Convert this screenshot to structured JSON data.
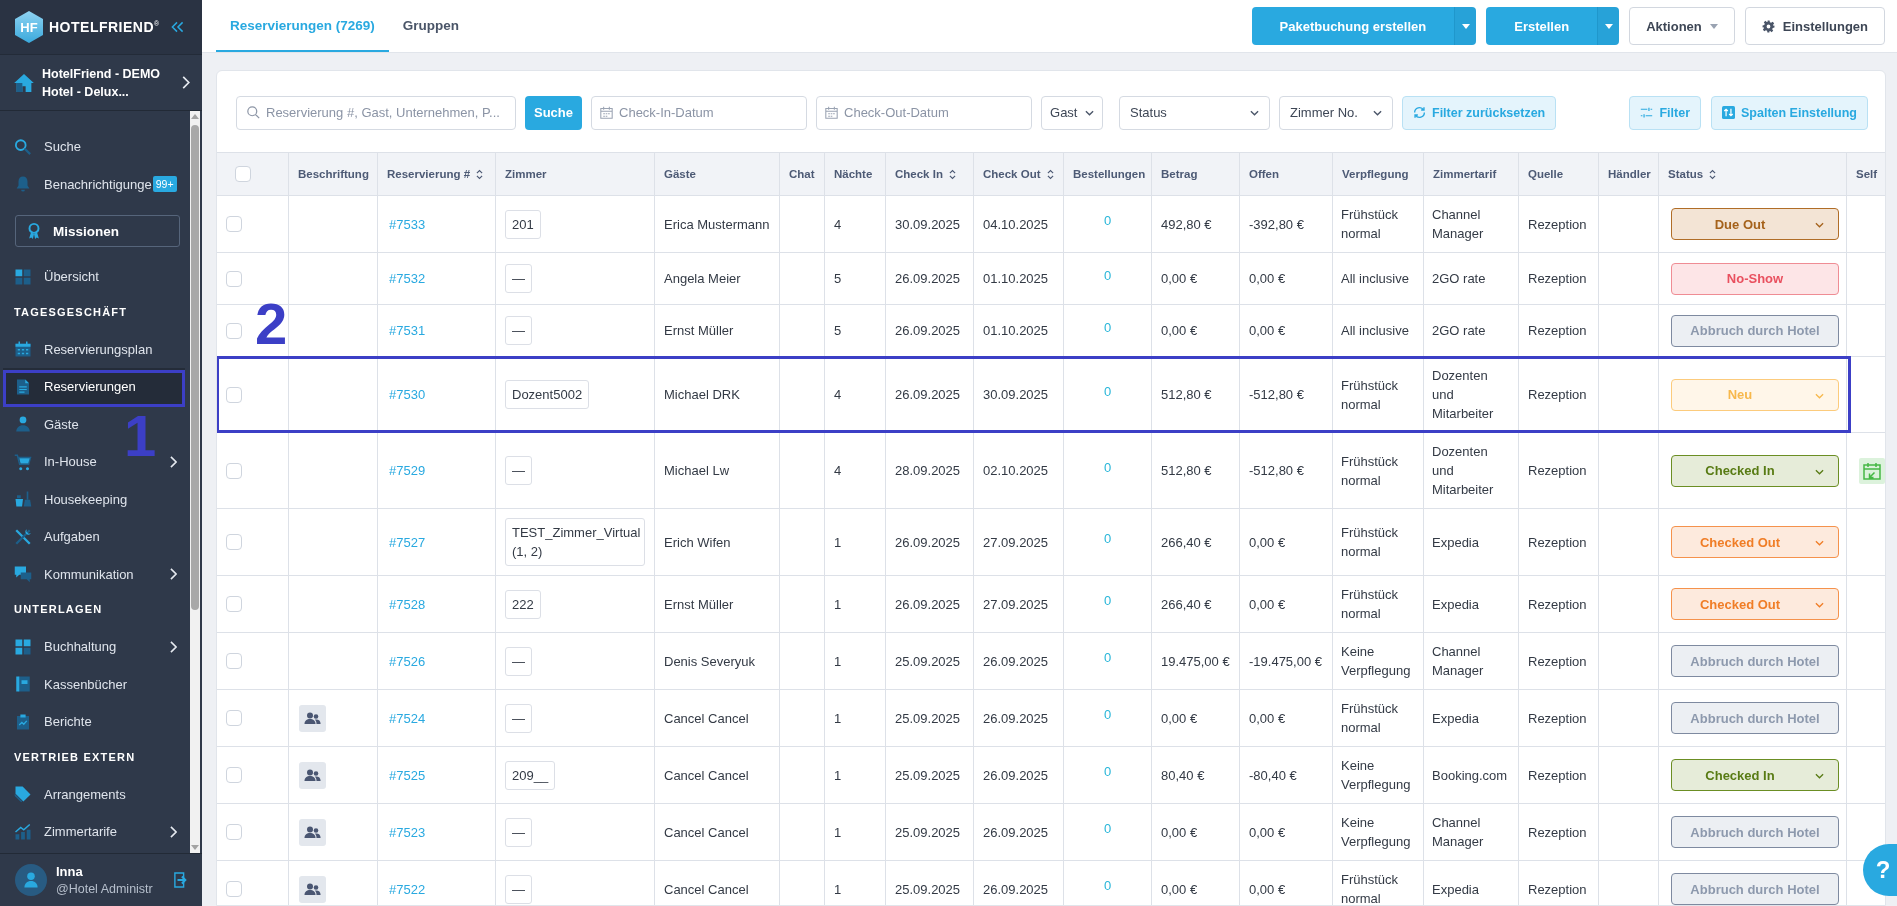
{
  "sidebar": {
    "logo": {
      "mark": "HF",
      "text": "HOTELFRIEND$^{®}$"
    },
    "hotel": "HotelFriend - DEMO Hotel - Delux...",
    "nav": [
      {
        "kind": "item",
        "label": "Suche",
        "selected": false,
        "submenu": false
      },
      {
        "kind": "item",
        "label": "Benachrichtigunge",
        "selected": false,
        "submenu": false,
        "badge": "99+"
      },
      {
        "kind": "button",
        "label": "Missionen"
      },
      {
        "kind": "item",
        "label": "Übersicht",
        "selected": false,
        "submenu": false
      },
      {
        "kind": "section",
        "label": "TAGESGESCHÄFT"
      },
      {
        "kind": "item",
        "label": "Reservierungsplan",
        "selected": false,
        "submenu": false
      },
      {
        "kind": "item",
        "label": "Reservierungen",
        "selected": true,
        "submenu": false,
        "callout": "1"
      },
      {
        "kind": "item",
        "label": "Gäste",
        "selected": false,
        "submenu": false
      },
      {
        "kind": "item",
        "label": "In-House",
        "selected": false,
        "submenu": true
      },
      {
        "kind": "item",
        "label": "Housekeeping",
        "selected": false,
        "submenu": false
      },
      {
        "kind": "item",
        "label": "Aufgaben",
        "selected": false,
        "submenu": false
      },
      {
        "kind": "item",
        "label": "Kommunikation",
        "selected": false,
        "submenu": true
      },
      {
        "kind": "section",
        "label": "UNTERLAGEN"
      },
      {
        "kind": "item",
        "label": "Buchhaltung",
        "selected": false,
        "submenu": true
      },
      {
        "kind": "item",
        "label": "Kassenbücher",
        "selected": false,
        "submenu": false
      },
      {
        "kind": "item",
        "label": "Berichte",
        "selected": false,
        "submenu": false
      },
      {
        "kind": "section",
        "label": "VERTRIEB EXTERN"
      },
      {
        "kind": "item",
        "label": "Arrangements",
        "selected": false,
        "submenu": false
      },
      {
        "kind": "item",
        "label": "Zimmertarife",
        "selected": false,
        "submenu": true
      }
    ],
    "user": {
      "name": "Inna",
      "role": "@Hotel Administr"
    }
  },
  "top_bar": {
    "tabs": [
      {
        "label": "Reservierungen (7269)",
        "selected": true
      },
      {
        "label": "Gruppen",
        "selected": false
      }
    ],
    "buttons": [
      {
        "label": "Paketbuchung erstellen",
        "kind": "split"
      },
      {
        "label": "Erstellen",
        "kind": "split"
      },
      {
        "label": "Aktionen",
        "kind": "dropdown"
      },
      {
        "label": "Einstellungen",
        "kind": "settings"
      }
    ]
  },
  "filters": {
    "search": {
      "placeholder": "Reservierung #, Gast, Unternehmen, P..."
    },
    "search_button": "Suche",
    "check_in": {
      "placeholder": "Check-In-Datum"
    },
    "check_out": {
      "placeholder": "Check-Out-Datum"
    },
    "selects": [
      {
        "label": "Gast"
      },
      {
        "label": "Status"
      },
      {
        "label": "Zimmer No."
      }
    ],
    "reset_button": "Filter zurücksetzen",
    "filter_button": "Filter",
    "columns_button": "Spalten Einstellung"
  },
  "table": {
    "select_all": {
      "checked": false
    },
    "columns": [
      {
        "label": "Beschriftung",
        "sortable": false
      },
      {
        "label": "Reservierung #",
        "sortable": true
      },
      {
        "label": "Zimmer",
        "sortable": false
      },
      {
        "label": "Gäste",
        "sortable": false
      },
      {
        "label": "Chat",
        "sortable": false
      },
      {
        "label": "Nächte",
        "sortable": false
      },
      {
        "label": "Check In",
        "sortable": true
      },
      {
        "label": "Check Out",
        "sortable": true
      },
      {
        "label": "Bestellungen",
        "sortable": false
      },
      {
        "label": "Betrag",
        "sortable": false
      },
      {
        "label": "Offen",
        "sortable": false
      },
      {
        "label": "Verpflegung",
        "sortable": false
      },
      {
        "label": "Zimmertarif",
        "sortable": false
      },
      {
        "label": "Quelle",
        "sortable": false
      },
      {
        "label": "Händler",
        "sortable": false
      },
      {
        "label": "Status",
        "sortable": true
      },
      {
        "label": "Self",
        "sortable": false
      }
    ],
    "rows": [
      {
        "checked": false,
        "label_icon": false,
        "number": "#7533",
        "room": "201",
        "guest": "Erica Mustermann",
        "nights": "4",
        "check_in": "30.09.2025",
        "check_out": "04.10.2025",
        "orders": "0",
        "amount": "492,80 €",
        "open": "-392,80 €",
        "board": "Frühstück normal",
        "rate": "Channel Manager",
        "source": "Rezeption",
        "status": {
          "label": "Due Out",
          "kind": "due_out",
          "dropdown": true
        },
        "self_checkin": false
      },
      {
        "checked": false,
        "label_icon": false,
        "number": "#7532",
        "room": "—",
        "guest": "Angela Meier",
        "nights": "5",
        "check_in": "26.09.2025",
        "check_out": "01.10.2025",
        "orders": "0",
        "amount": "0,00 €",
        "open": "0,00 €",
        "board": "All inclusive",
        "rate": "2GO rate",
        "source": "Rezeption",
        "status": {
          "label": "No-Show",
          "kind": "no_show",
          "dropdown": false
        },
        "self_checkin": false
      },
      {
        "checked": false,
        "label_icon": false,
        "number": "#7531",
        "room": "—",
        "guest": "Ernst Müller",
        "nights": "5",
        "check_in": "26.09.2025",
        "check_out": "01.10.2025",
        "orders": "0",
        "amount": "0,00 €",
        "open": "0,00 €",
        "board": "All inclusive",
        "rate": "2GO rate",
        "source": "Rezeption",
        "status": {
          "label": "Abbruch durch Hotel",
          "kind": "cancelled",
          "dropdown": false
        },
        "self_checkin": false
      },
      {
        "checked": false,
        "label_icon": false,
        "number": "#7530",
        "room": "Dozent5002",
        "guest": "Michael DRK",
        "nights": "4",
        "check_in": "26.09.2025",
        "check_out": "30.09.2025",
        "orders": "0",
        "amount": "512,80 €",
        "open": "-512,80 €",
        "board": "Frühstück normal",
        "rate": "Dozenten und Mitarbeiter",
        "source": "Rezeption",
        "status": {
          "label": "Neu",
          "kind": "new",
          "dropdown": true
        },
        "self_checkin": false,
        "callout": "2"
      },
      {
        "checked": false,
        "label_icon": false,
        "number": "#7529",
        "room": "—",
        "guest": "Michael Lw",
        "nights": "4",
        "check_in": "28.09.2025",
        "check_out": "02.10.2025",
        "orders": "0",
        "amount": "512,80 €",
        "open": "-512,80 €",
        "board": "Frühstück normal",
        "rate": "Dozenten und Mitarbeiter",
        "source": "Rezeption",
        "status": {
          "label": "Checked In",
          "kind": "checked_in",
          "dropdown": true
        },
        "self_checkin": true
      },
      {
        "checked": false,
        "label_icon": false,
        "number": "#7527",
        "room": "TEST_Zimmer_Virtual (1, 2)",
        "guest": "Erich Wifen",
        "nights": "1",
        "check_in": "26.09.2025",
        "check_out": "27.09.2025",
        "orders": "0",
        "amount": "266,40 €",
        "open": "0,00 €",
        "board": "Frühstück normal",
        "rate": "Expedia",
        "source": "Rezeption",
        "status": {
          "label": "Checked Out",
          "kind": "checked_out",
          "dropdown": true
        },
        "self_checkin": false
      },
      {
        "checked": false,
        "label_icon": false,
        "number": "#7528",
        "room": "222",
        "guest": "Ernst Müller",
        "nights": "1",
        "check_in": "26.09.2025",
        "check_out": "27.09.2025",
        "orders": "0",
        "amount": "266,40 €",
        "open": "0,00 €",
        "board": "Frühstück normal",
        "rate": "Expedia",
        "source": "Rezeption",
        "status": {
          "label": "Checked Out",
          "kind": "checked_out",
          "dropdown": true
        },
        "self_checkin": false
      },
      {
        "checked": false,
        "label_icon": false,
        "number": "#7526",
        "room": "—",
        "guest": "Denis Severyuk",
        "nights": "1",
        "check_in": "25.09.2025",
        "check_out": "26.09.2025",
        "orders": "0",
        "amount": "19.475,00 €",
        "open": "-19.475,00 €",
        "board": "Keine Verpflegung",
        "rate": "Channel Manager",
        "source": "Rezeption",
        "status": {
          "label": "Abbruch durch Hotel",
          "kind": "cancelled",
          "dropdown": false
        },
        "self_checkin": false
      },
      {
        "checked": false,
        "label_icon": true,
        "number": "#7524",
        "room": "—",
        "guest": "Cancel Cancel",
        "nights": "1",
        "check_in": "25.09.2025",
        "check_out": "26.09.2025",
        "orders": "0",
        "amount": "0,00 €",
        "open": "0,00 €",
        "board": "Frühstück normal",
        "rate": "Expedia",
        "source": "Rezeption",
        "status": {
          "label": "Abbruch durch Hotel",
          "kind": "cancelled",
          "dropdown": false
        },
        "self_checkin": false
      },
      {
        "checked": false,
        "label_icon": true,
        "number": "#7525",
        "room": "209__",
        "guest": "Cancel Cancel",
        "nights": "1",
        "check_in": "25.09.2025",
        "check_out": "26.09.2025",
        "orders": "0",
        "amount": "80,40 €",
        "open": "-80,40 €",
        "board": "Keine Verpflegung",
        "rate": "Booking.com",
        "source": "Rezeption",
        "status": {
          "label": "Checked In",
          "kind": "checked_in",
          "dropdown": true
        },
        "self_checkin": false
      },
      {
        "checked": false,
        "label_icon": true,
        "number": "#7523",
        "room": "—",
        "guest": "Cancel Cancel",
        "nights": "1",
        "check_in": "25.09.2025",
        "check_out": "26.09.2025",
        "orders": "0",
        "amount": "0,00 €",
        "open": "0,00 €",
        "board": "Keine Verpflegung",
        "rate": "Channel Manager",
        "source": "Rezeption",
        "status": {
          "label": "Abbruch durch Hotel",
          "kind": "cancelled",
          "dropdown": false
        },
        "self_checkin": false
      },
      {
        "checked": false,
        "label_icon": true,
        "number": "#7522",
        "room": "—",
        "guest": "Cancel Cancel",
        "nights": "1",
        "check_in": "25.09.2025",
        "check_out": "26.09.2025",
        "orders": "0",
        "amount": "0,00 €",
        "open": "0,00 €",
        "board": "Frühstück normal",
        "rate": "Expedia",
        "source": "Rezeption",
        "status": {
          "label": "Abbruch durch Hotel",
          "kind": "cancelled",
          "dropdown": false
        },
        "self_checkin": false
      }
    ]
  },
  "help_button": {
    "label": "?"
  }
}
